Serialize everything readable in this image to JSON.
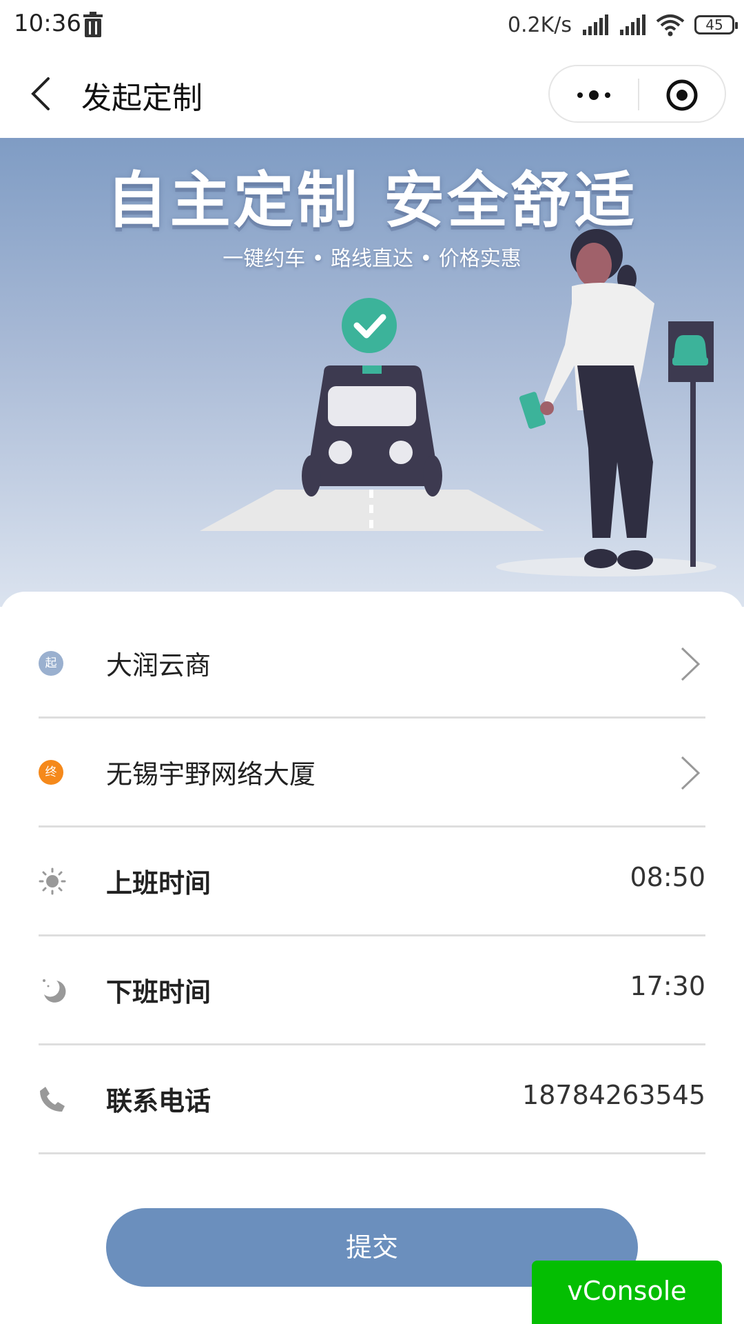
{
  "status_bar": {
    "time": "10:36",
    "net_speed": "0.2K/s",
    "battery": "45"
  },
  "nav": {
    "title": "发起定制"
  },
  "banner": {
    "title": "自主定制  安全舒适",
    "subtitle": "一键约车 • 路线直达 • 价格实惠"
  },
  "form": {
    "start": {
      "badge": "起",
      "value": "大润云商",
      "badge_color": "#9ab0cf"
    },
    "end": {
      "badge": "终",
      "value": "无锡宇野网络大厦",
      "badge_color": "#f5891b"
    },
    "work_start": {
      "label": "上班时间",
      "value": "08:50"
    },
    "work_end": {
      "label": "下班时间",
      "value": "17:30"
    },
    "phone": {
      "label": "联系电话",
      "value": "18784263545"
    }
  },
  "submit_label": "提交",
  "vconsole_label": "vConsole",
  "colors": {
    "accent": "#6b8fbd",
    "vconsole": "#04be02",
    "teal": "#3cb39a"
  }
}
